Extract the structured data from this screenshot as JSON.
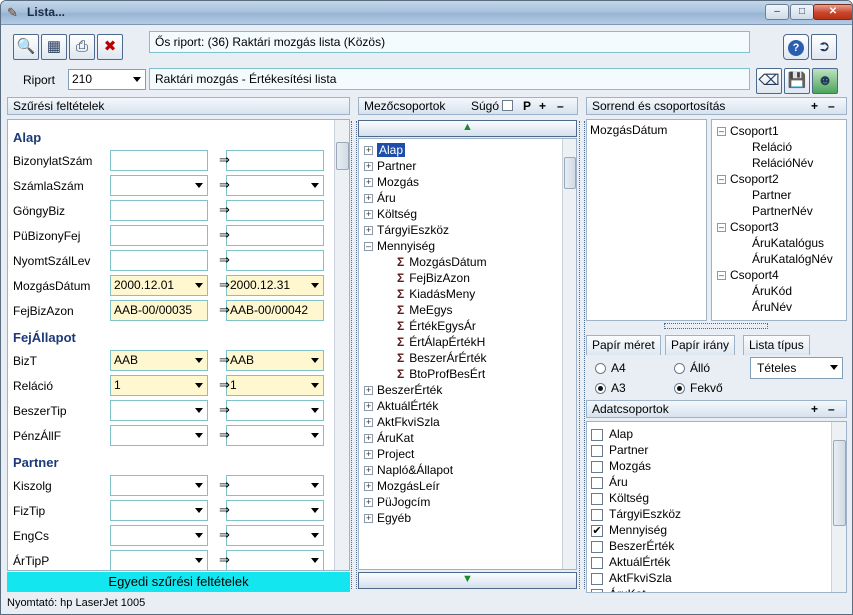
{
  "window": {
    "title": "Lista...",
    "minimize": "–",
    "maximize": "□",
    "close": "✕"
  },
  "header": {
    "parent_report": "Ős riport: (36)  Raktári mozgás lista (Közös)",
    "report_label": "Riport",
    "report_id": "210",
    "report_name": "Raktári mozgás - Értékesítési lista"
  },
  "filters": {
    "title": "Szűrési feltételek",
    "arrow": "⇒",
    "groups": {
      "alap": "Alap",
      "fejallapot": "FejÁllapot",
      "partner": "Partner"
    },
    "rows": [
      {
        "label": "BizonylatSzám",
        "from": "",
        "to": ""
      },
      {
        "label": "SzámlaSzám",
        "from": "",
        "to": ""
      },
      {
        "label": "GöngyBiz",
        "from": "",
        "to": ""
      },
      {
        "label": "PüBizonyFej",
        "from": "",
        "to": ""
      },
      {
        "label": "NyomtSzálLev",
        "from": "",
        "to": ""
      },
      {
        "label": "MozgásDátum",
        "from": "2000.12.01",
        "to": "2000.12.31"
      },
      {
        "label": "FejBizAzon",
        "from": "AAB-00/00035",
        "to": "AAB-00/00042"
      },
      {
        "label": "BizT",
        "from": "AAB",
        "to": "AAB"
      },
      {
        "label": "Reláció",
        "from": "1",
        "to": "1"
      },
      {
        "label": "BeszerTip",
        "from": "",
        "to": ""
      },
      {
        "label": "PénzÁllF",
        "from": "",
        "to": ""
      },
      {
        "label": "Kiszolg",
        "from": "",
        "to": ""
      },
      {
        "label": "FizTip",
        "from": "",
        "to": ""
      },
      {
        "label": "EngCs",
        "from": "",
        "to": ""
      },
      {
        "label": "ÁrTipP",
        "from": "",
        "to": ""
      }
    ],
    "custom_button": "Egyedi szűrési feltételek"
  },
  "fieldgroups": {
    "title": "Mezőcsoportok",
    "help": "Súgó",
    "p": "P",
    "plus": "+",
    "minus": "–",
    "items": [
      "Alap",
      "Partner",
      "Mozgás",
      "Áru",
      "Költség",
      "TárgyiEszköz",
      "Mennyiség"
    ],
    "mennyiseg_children": [
      "MozgásDátum",
      "FejBizAzon",
      "KiadásMeny",
      "MeEgys",
      "ÉrtékEgysÁr",
      "ÉrtÁlapÉrtékH",
      "BeszerÁrÉrték",
      "BtoProfBesÉrt"
    ],
    "rest": [
      "BeszerÉrték",
      "AktuálÉrték",
      "AktFkviSzla",
      "ÁruKat",
      "Project",
      "Napló&Állapot",
      "MozgásLeír",
      "PüJogcím",
      "Egyéb"
    ]
  },
  "order": {
    "title": "Sorrend és csoportosítás",
    "sort_field": "MozgásDátum",
    "groups": [
      {
        "name": "Csoport1",
        "children": [
          "Reláció",
          "RelációNév"
        ]
      },
      {
        "name": "Csoport2",
        "children": [
          "Partner",
          "PartnerNév"
        ]
      },
      {
        "name": "Csoport3",
        "children": [
          "ÁruKatalógus",
          "ÁruKatalógNév"
        ]
      },
      {
        "name": "Csoport4",
        "children": [
          "ÁruKód",
          "ÁruNév"
        ]
      }
    ]
  },
  "paper": {
    "size_label": "Papír méret",
    "orient_label": "Papír irány",
    "list_type_label": "Lista típus",
    "a4": "A4",
    "a3": "A3",
    "portrait": "Álló",
    "landscape": "Fekvő",
    "list_type": "Tételes"
  },
  "datagroups": {
    "title": "Adatcsoportok",
    "items": [
      {
        "label": "Alap",
        "checked": false
      },
      {
        "label": "Partner",
        "checked": false
      },
      {
        "label": "Mozgás",
        "checked": false
      },
      {
        "label": "Áru",
        "checked": false
      },
      {
        "label": "Költség",
        "checked": false
      },
      {
        "label": "TárgyiEszköz",
        "checked": false
      },
      {
        "label": "Mennyiség",
        "checked": true
      },
      {
        "label": "BeszerÉrték",
        "checked": false
      },
      {
        "label": "AktuálÉrték",
        "checked": false
      },
      {
        "label": "AktFkviSzla",
        "checked": false
      },
      {
        "label": "ÁruKat",
        "checked": false
      }
    ]
  },
  "status": {
    "printer": "Nyomtató: hp LaserJet 1005"
  }
}
